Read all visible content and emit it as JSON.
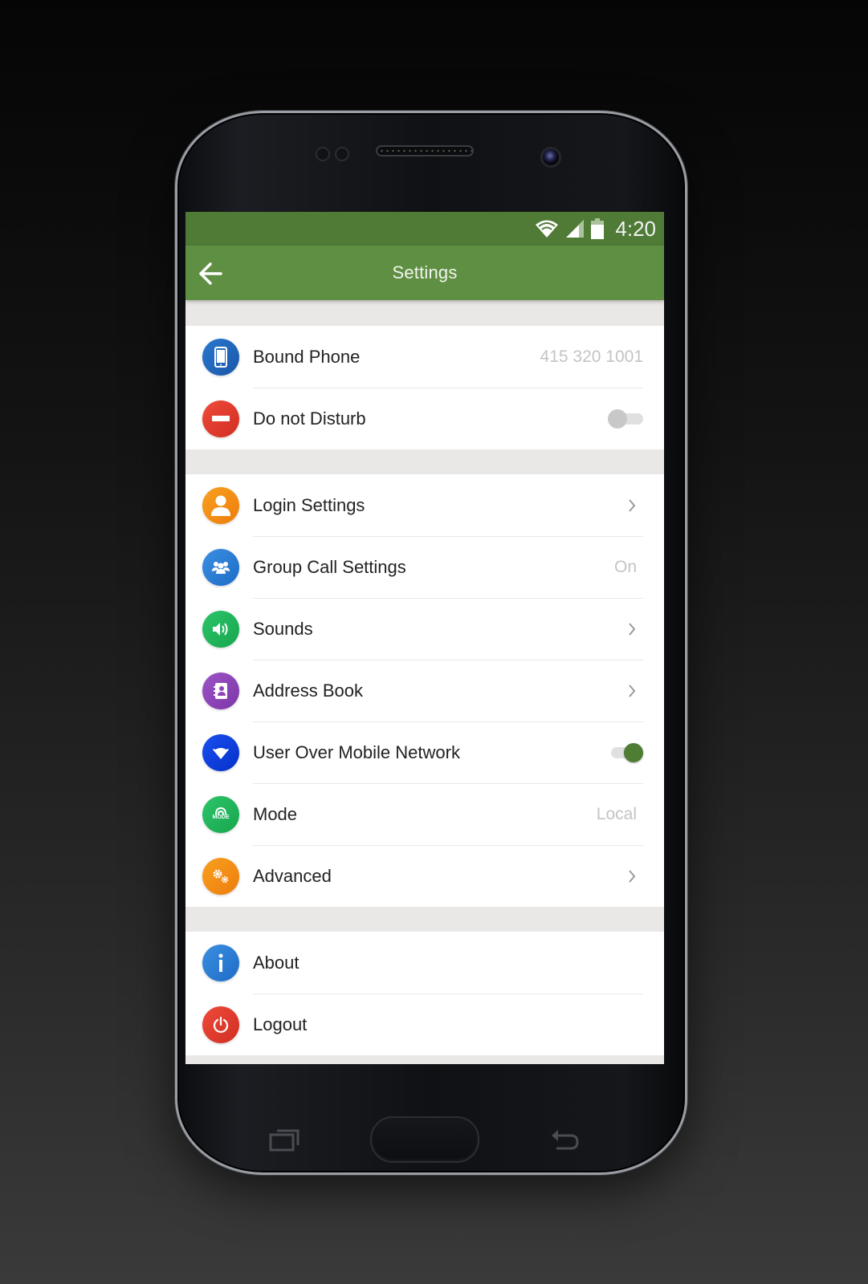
{
  "status_bar": {
    "time": "4:20",
    "icons": [
      "wifi-icon",
      "cell-signal-icon",
      "battery-icon"
    ]
  },
  "app_bar": {
    "title": "Settings",
    "back_icon": "arrow-left-icon"
  },
  "groups": [
    {
      "items": [
        {
          "label": "Bound Phone",
          "icon": "smartphone-icon",
          "icon_color": "#1e63b5",
          "value": "415 320 1001",
          "control": "value"
        },
        {
          "label": "Do not Disturb",
          "icon": "minus-circle-icon",
          "icon_color": "#e23b2f",
          "control": "toggle",
          "toggle_on": false
        }
      ]
    },
    {
      "items": [
        {
          "label": "Login Settings",
          "icon": "user-icon",
          "icon_color": "#f38a12",
          "control": "chevron"
        },
        {
          "label": "Group Call Settings",
          "icon": "group-icon",
          "icon_color": "#2a7fd6",
          "value": "On",
          "control": "value"
        },
        {
          "label": "Sounds",
          "icon": "speaker-icon",
          "icon_color": "#1fb45a",
          "control": "chevron"
        },
        {
          "label": "Address Book",
          "icon": "contacts-book-icon",
          "icon_color": "#8e44b8",
          "control": "chevron"
        },
        {
          "label": "User Over Mobile Network",
          "icon": "wifi-icon",
          "icon_color": "#0a3ee0",
          "control": "toggle",
          "toggle_on": true
        },
        {
          "label": "Mode",
          "icon": "mode-icon",
          "icon_color": "#22b55b",
          "value": "Local",
          "control": "value"
        },
        {
          "label": "Advanced",
          "icon": "gears-icon",
          "icon_color": "#f28a14",
          "control": "chevron"
        }
      ]
    },
    {
      "items": [
        {
          "label": "About",
          "icon": "info-icon",
          "icon_color": "#2a7fd6",
          "control": "none"
        },
        {
          "label": "Logout",
          "icon": "power-icon",
          "icon_color": "#e23b2f",
          "control": "none"
        }
      ]
    }
  ],
  "mode_icon_text": "MODE",
  "colors": {
    "status_bar": "#4f7b37",
    "app_bar": "#5f8f43",
    "toggle_on": "#4e7d33",
    "section_gap": "#eae7e7"
  },
  "nav_bar": [
    "recent-apps-icon",
    "home-button",
    "back-icon"
  ]
}
